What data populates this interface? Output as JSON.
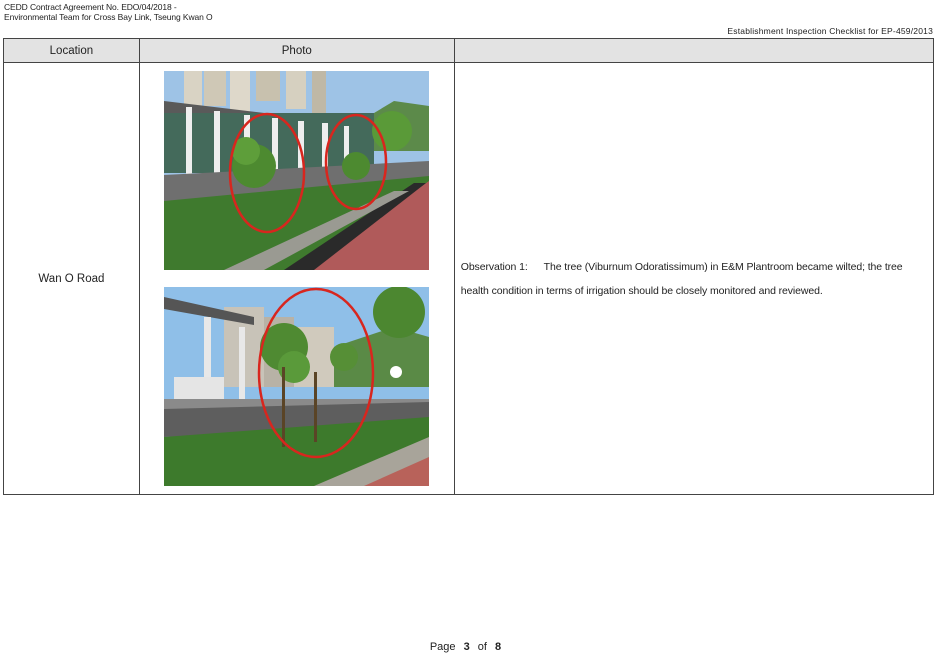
{
  "header": {
    "line1": "CEDD Contract Agreement No. EDO/04/2018 -",
    "line2": "Environmental Team for Cross Bay Link, Tseung Kwan O",
    "right_title": "Establishment Inspection Checklist for EP-459/2013"
  },
  "table": {
    "headers": [
      "Location",
      "Photo",
      ""
    ],
    "row": {
      "location": "Wan O Road",
      "observation_label": "Observation 1:",
      "observation_text": "The tree (Viburnum Odoratissimum) in E&M Plantroom became wilted; the tree health condition in terms of irrigation should be closely monitored and reviewed."
    }
  },
  "footer": {
    "page_word": "Page",
    "page_number": "3",
    "of_word": "of",
    "page_total": "8"
  }
}
